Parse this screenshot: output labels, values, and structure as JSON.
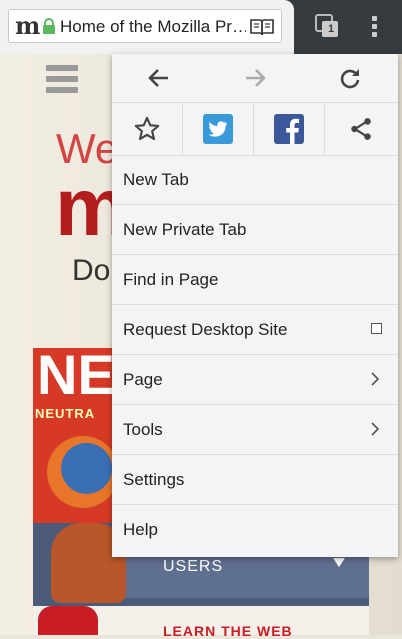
{
  "toolbar": {
    "site_letter": "m",
    "page_title": "Home of the Mozilla Pr…",
    "tab_count": "1",
    "icons": {
      "site": "mozilla-m-icon",
      "lock": "lock-icon",
      "reader": "reader-mode-icon",
      "tabs": "tabs-icon",
      "overflow": "overflow-menu-icon"
    }
  },
  "page": {
    "heading_partial": "We",
    "logo_partial": "m",
    "sub_partial": "Do",
    "promo_ne": "NE",
    "promo_neutra": "NEUTRA",
    "promo_users": "USERS",
    "promo_learn": "LEARN THE WEB"
  },
  "menu": {
    "nav": [
      {
        "name": "back-icon"
      },
      {
        "name": "forward-icon"
      },
      {
        "name": "reload-icon"
      }
    ],
    "share": [
      {
        "name": "star-icon"
      },
      {
        "name": "twitter-icon"
      },
      {
        "name": "facebook-icon"
      },
      {
        "name": "share-icon"
      }
    ],
    "items": [
      {
        "label": "New Tab"
      },
      {
        "label": "New Private Tab"
      },
      {
        "label": "Find in Page"
      },
      {
        "label": "Request Desktop Site",
        "checked": false
      },
      {
        "label": "Page"
      },
      {
        "label": "Tools"
      },
      {
        "label": "Settings"
      },
      {
        "label": "Help"
      }
    ]
  },
  "colors": {
    "toolbar": "#363b40",
    "menu_bg": "#f4f4f6",
    "twitter": "#3a9ad9",
    "facebook": "#3b5998",
    "lock_green": "#5cb85c"
  }
}
